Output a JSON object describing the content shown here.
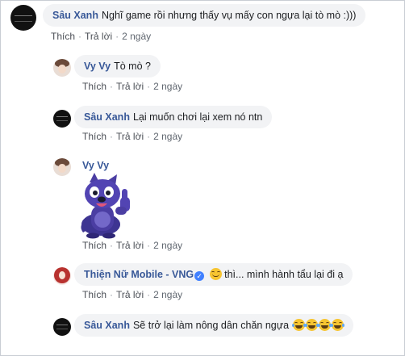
{
  "comments": [
    {
      "author": "Sâu Xanh",
      "text": "Nghĩ game rồi nhưng thấy vụ mấy con ngựa lại tò mò :)))",
      "actions": {
        "like": "Thích",
        "reply": "Trả lời",
        "time": "2 ngày"
      }
    },
    {
      "author": "Vy Vy",
      "text": "Tò mò ?",
      "actions": {
        "like": "Thích",
        "reply": "Trả lời",
        "time": "2 ngày"
      }
    },
    {
      "author": "Sâu Xanh",
      "text": "Lại muốn chơi lại xem nó ntn",
      "actions": {
        "like": "Thích",
        "reply": "Trả lời",
        "time": "2 ngày"
      }
    },
    {
      "author": "Vy Vy",
      "sticker": "purple-dog-thumbs-up-sticker",
      "actions": {
        "like": "Thích",
        "reply": "Trả lời",
        "time": "2 ngày"
      }
    },
    {
      "author": "Thiện Nữ Mobile - VNG",
      "verified": true,
      "text": "thì... mình hành tẩu lại đi ạ",
      "emoji_prefix": "smile",
      "actions": {
        "like": "Thích",
        "reply": "Trả lời",
        "time": "2 ngày"
      }
    },
    {
      "author": "Sâu Xanh",
      "text": "Sẽ trở lại làm nông dân chăn ngựa",
      "emoji_suffix": [
        "laugh-tears",
        "laugh-tears",
        "laugh-tears",
        "laugh-tears"
      ]
    }
  ],
  "separator": "·",
  "verified_mark": "✓",
  "colors": {
    "name": "#385898",
    "bubble": "#f2f3f5",
    "meta": "#606770",
    "verified": "#4080ff",
    "sticker": "#4b3ea3"
  }
}
